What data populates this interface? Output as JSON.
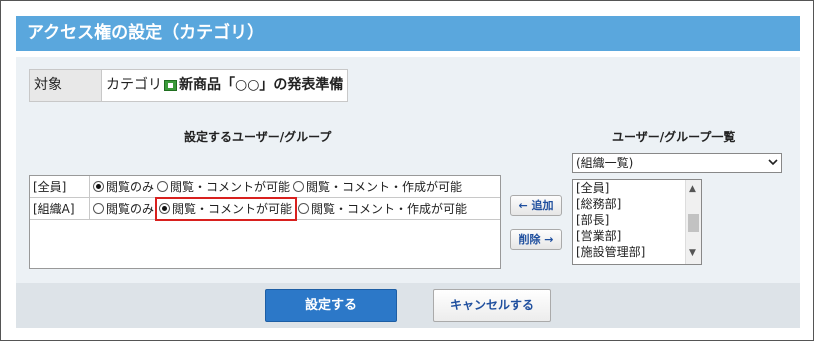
{
  "header": {
    "title": "アクセス権の設定（カテゴリ）"
  },
  "target": {
    "label": "対象",
    "prefix": "カテゴリ",
    "category_name": "新商品「○○」の発表準備"
  },
  "left_section": {
    "title": "設定するユーザー/グループ"
  },
  "right_section": {
    "title": "ユーザー/グループ一覧"
  },
  "permissions": {
    "options": [
      "閲覧のみ",
      "閲覧・コメントが可能",
      "閲覧・コメント・作成が可能"
    ],
    "rows": [
      {
        "name": "[全員]",
        "selected_index": 0
      },
      {
        "name": "[組織A]",
        "selected_index": 1
      }
    ]
  },
  "actions": {
    "add_label": "← 追加",
    "remove_label": "削除 →"
  },
  "group_select": {
    "value": "(組織一覧)"
  },
  "group_list": [
    "[全員]",
    "[総務部]",
    "[部長]",
    "[営業部]",
    "[施設管理部]"
  ],
  "footer": {
    "submit_label": "設定する",
    "cancel_label": "キャンセルする"
  },
  "colors": {
    "header_bg": "#5aa7dd",
    "primary_button": "#2c78c8",
    "highlight": "#d8201e"
  }
}
